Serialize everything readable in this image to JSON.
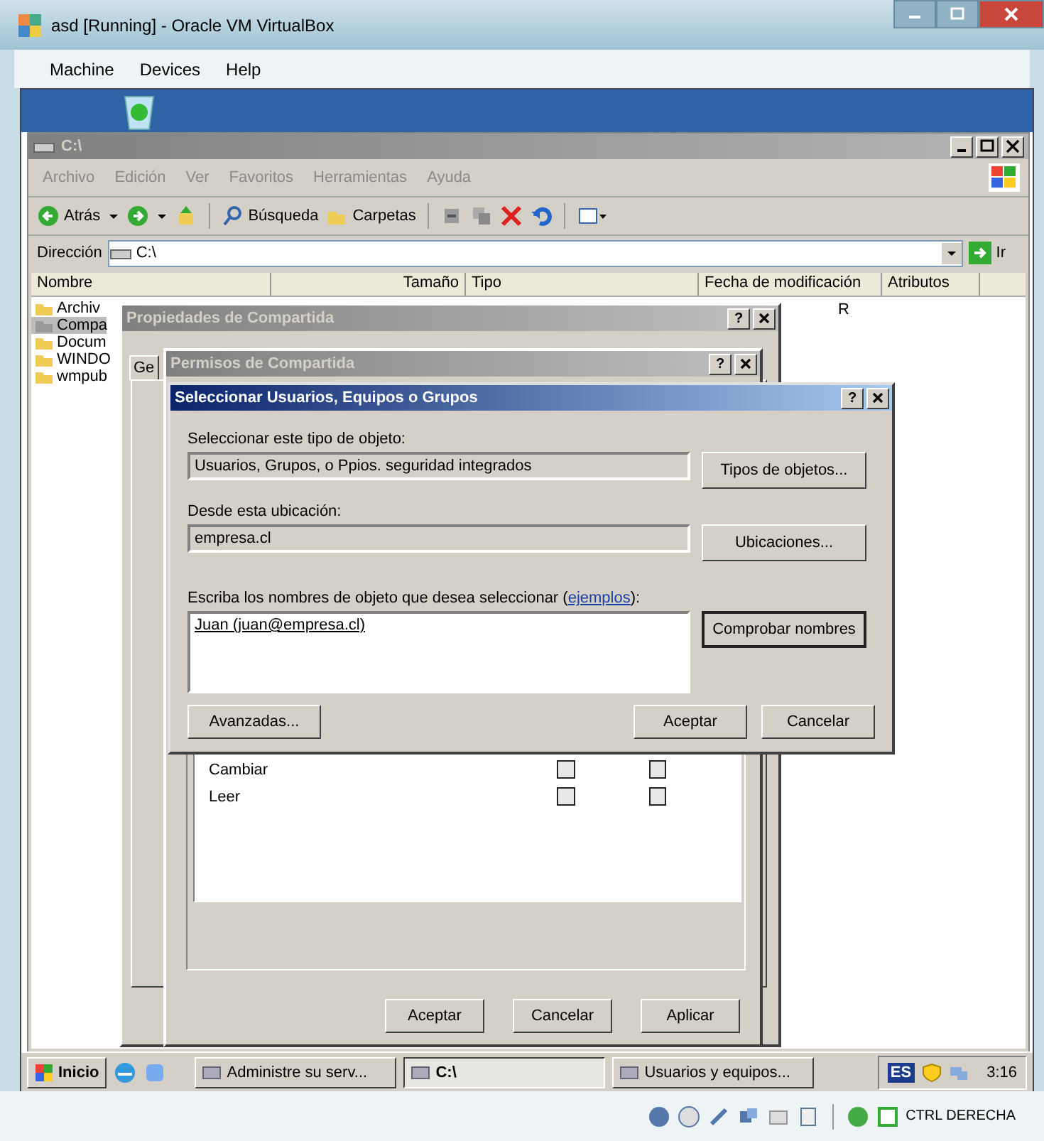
{
  "window": {
    "title": "asd [Running] - Oracle VM VirtualBox"
  },
  "menu": [
    "Machine",
    "Devices",
    "Help"
  ],
  "explorer": {
    "title": "C:\\",
    "menu": [
      "Archivo",
      "Edición",
      "Ver",
      "Favoritos",
      "Herramientas",
      "Ayuda"
    ],
    "toolbar": {
      "back": "Atrás",
      "search": "Búsqueda",
      "folders": "Carpetas"
    },
    "address_label": "Dirección",
    "address": "C:\\",
    "go": "Ir",
    "columns": [
      "Nombre",
      "Tamaño",
      "Tipo",
      "Fecha de modificación",
      "Atributos"
    ],
    "files": [
      {
        "name": "Archiv",
        "selected": false
      },
      {
        "name": "Compa",
        "selected": true
      },
      {
        "name": "Docum",
        "selected": false
      },
      {
        "name": "WINDO",
        "selected": false
      },
      {
        "name": "wmpub",
        "selected": false
      }
    ],
    "attribute": "R"
  },
  "properties_dialog": {
    "title": "Propiedades de Compartida",
    "help": "?",
    "tab": "Ge"
  },
  "permissions_dialog": {
    "title": "Permisos de Compartida",
    "help": "?",
    "permissions": [
      {
        "name": "Cambiar",
        "allow": false,
        "deny": false
      },
      {
        "name": "Leer",
        "allow": false,
        "deny": false
      }
    ],
    "buttons": [
      "Aceptar",
      "Cancelar",
      "Aplicar"
    ]
  },
  "select_dialog": {
    "title": "Seleccionar Usuarios, Equipos o Grupos",
    "help": "?",
    "type_label": "Seleccionar este tipo de objeto:",
    "type_value": "Usuarios, Grupos, o Ppios. seguridad integrados",
    "type_button": "Tipos de objetos...",
    "location_label": "Desde esta ubicación:",
    "location_value": "empresa.cl",
    "location_button": "Ubicaciones...",
    "names_label": "Escriba los nombres de objeto que desea seleccionar (",
    "names_link": "ejemplos",
    "names_label_end": "):",
    "names_value": "Juan (juan@empresa.cl)",
    "check_button": "Comprobar nombres",
    "advanced_button": "Avanzadas...",
    "ok_button": "Aceptar",
    "cancel_button": "Cancelar"
  },
  "taskbar": {
    "start": "Inicio",
    "tasks": [
      {
        "label": "Administre su serv...",
        "selected": false
      },
      {
        "label": "C:\\",
        "selected": true
      },
      {
        "label": "Usuarios y equipos...",
        "selected": false
      }
    ],
    "language": "ES",
    "clock": "3:16"
  },
  "status_bar": {
    "host_key": "CTRL DERECHA"
  }
}
